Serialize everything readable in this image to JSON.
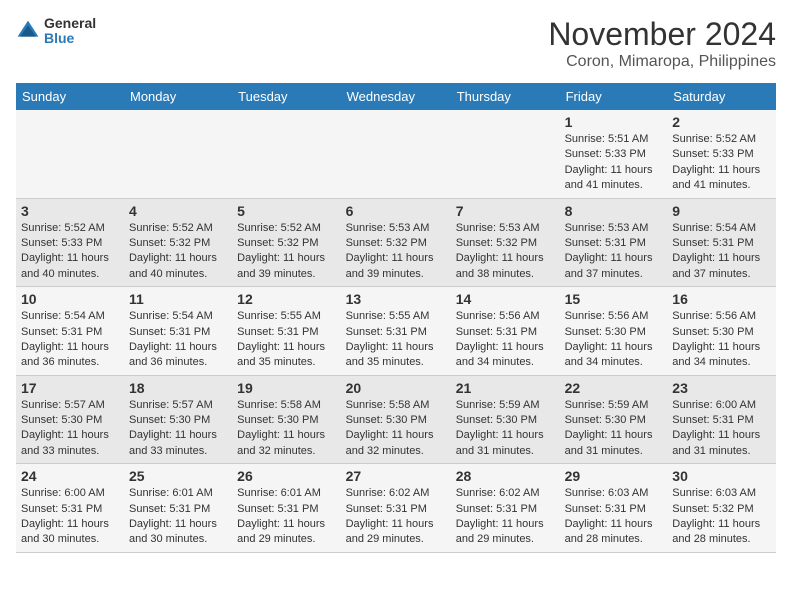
{
  "header": {
    "logo": {
      "line1": "General",
      "line2": "Blue"
    },
    "title": "November 2024",
    "subtitle": "Coron, Mimaropa, Philippines"
  },
  "days_of_week": [
    "Sunday",
    "Monday",
    "Tuesday",
    "Wednesday",
    "Thursday",
    "Friday",
    "Saturday"
  ],
  "weeks": [
    [
      {
        "day": "",
        "info": ""
      },
      {
        "day": "",
        "info": ""
      },
      {
        "day": "",
        "info": ""
      },
      {
        "day": "",
        "info": ""
      },
      {
        "day": "",
        "info": ""
      },
      {
        "day": "1",
        "info": "Sunrise: 5:51 AM\nSunset: 5:33 PM\nDaylight: 11 hours and 41 minutes."
      },
      {
        "day": "2",
        "info": "Sunrise: 5:52 AM\nSunset: 5:33 PM\nDaylight: 11 hours and 41 minutes."
      }
    ],
    [
      {
        "day": "3",
        "info": "Sunrise: 5:52 AM\nSunset: 5:33 PM\nDaylight: 11 hours and 40 minutes."
      },
      {
        "day": "4",
        "info": "Sunrise: 5:52 AM\nSunset: 5:32 PM\nDaylight: 11 hours and 40 minutes."
      },
      {
        "day": "5",
        "info": "Sunrise: 5:52 AM\nSunset: 5:32 PM\nDaylight: 11 hours and 39 minutes."
      },
      {
        "day": "6",
        "info": "Sunrise: 5:53 AM\nSunset: 5:32 PM\nDaylight: 11 hours and 39 minutes."
      },
      {
        "day": "7",
        "info": "Sunrise: 5:53 AM\nSunset: 5:32 PM\nDaylight: 11 hours and 38 minutes."
      },
      {
        "day": "8",
        "info": "Sunrise: 5:53 AM\nSunset: 5:31 PM\nDaylight: 11 hours and 37 minutes."
      },
      {
        "day": "9",
        "info": "Sunrise: 5:54 AM\nSunset: 5:31 PM\nDaylight: 11 hours and 37 minutes."
      }
    ],
    [
      {
        "day": "10",
        "info": "Sunrise: 5:54 AM\nSunset: 5:31 PM\nDaylight: 11 hours and 36 minutes."
      },
      {
        "day": "11",
        "info": "Sunrise: 5:54 AM\nSunset: 5:31 PM\nDaylight: 11 hours and 36 minutes."
      },
      {
        "day": "12",
        "info": "Sunrise: 5:55 AM\nSunset: 5:31 PM\nDaylight: 11 hours and 35 minutes."
      },
      {
        "day": "13",
        "info": "Sunrise: 5:55 AM\nSunset: 5:31 PM\nDaylight: 11 hours and 35 minutes."
      },
      {
        "day": "14",
        "info": "Sunrise: 5:56 AM\nSunset: 5:31 PM\nDaylight: 11 hours and 34 minutes."
      },
      {
        "day": "15",
        "info": "Sunrise: 5:56 AM\nSunset: 5:30 PM\nDaylight: 11 hours and 34 minutes."
      },
      {
        "day": "16",
        "info": "Sunrise: 5:56 AM\nSunset: 5:30 PM\nDaylight: 11 hours and 34 minutes."
      }
    ],
    [
      {
        "day": "17",
        "info": "Sunrise: 5:57 AM\nSunset: 5:30 PM\nDaylight: 11 hours and 33 minutes."
      },
      {
        "day": "18",
        "info": "Sunrise: 5:57 AM\nSunset: 5:30 PM\nDaylight: 11 hours and 33 minutes."
      },
      {
        "day": "19",
        "info": "Sunrise: 5:58 AM\nSunset: 5:30 PM\nDaylight: 11 hours and 32 minutes."
      },
      {
        "day": "20",
        "info": "Sunrise: 5:58 AM\nSunset: 5:30 PM\nDaylight: 11 hours and 32 minutes."
      },
      {
        "day": "21",
        "info": "Sunrise: 5:59 AM\nSunset: 5:30 PM\nDaylight: 11 hours and 31 minutes."
      },
      {
        "day": "22",
        "info": "Sunrise: 5:59 AM\nSunset: 5:30 PM\nDaylight: 11 hours and 31 minutes."
      },
      {
        "day": "23",
        "info": "Sunrise: 6:00 AM\nSunset: 5:31 PM\nDaylight: 11 hours and 31 minutes."
      }
    ],
    [
      {
        "day": "24",
        "info": "Sunrise: 6:00 AM\nSunset: 5:31 PM\nDaylight: 11 hours and 30 minutes."
      },
      {
        "day": "25",
        "info": "Sunrise: 6:01 AM\nSunset: 5:31 PM\nDaylight: 11 hours and 30 minutes."
      },
      {
        "day": "26",
        "info": "Sunrise: 6:01 AM\nSunset: 5:31 PM\nDaylight: 11 hours and 29 minutes."
      },
      {
        "day": "27",
        "info": "Sunrise: 6:02 AM\nSunset: 5:31 PM\nDaylight: 11 hours and 29 minutes."
      },
      {
        "day": "28",
        "info": "Sunrise: 6:02 AM\nSunset: 5:31 PM\nDaylight: 11 hours and 29 minutes."
      },
      {
        "day": "29",
        "info": "Sunrise: 6:03 AM\nSunset: 5:31 PM\nDaylight: 11 hours and 28 minutes."
      },
      {
        "day": "30",
        "info": "Sunrise: 6:03 AM\nSunset: 5:32 PM\nDaylight: 11 hours and 28 minutes."
      }
    ]
  ]
}
